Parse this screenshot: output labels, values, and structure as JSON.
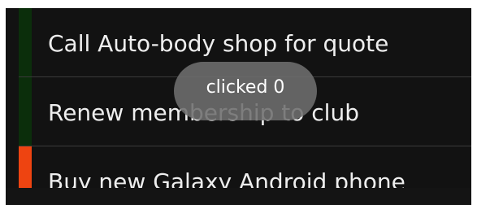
{
  "list": {
    "items": [
      {
        "label": "Call Auto-body shop for quote",
        "indicator_color": "#0b2e0b"
      },
      {
        "label": "Renew membership to club",
        "indicator_color": "#0b2e0b"
      },
      {
        "label": "Buy new Galaxy Android phone",
        "indicator_color": "#ee4411"
      }
    ]
  },
  "toast": {
    "text": "clicked 0"
  },
  "colors": {
    "background": "#121212",
    "text": "#eeeeee",
    "divider": "#3a3a3a"
  }
}
